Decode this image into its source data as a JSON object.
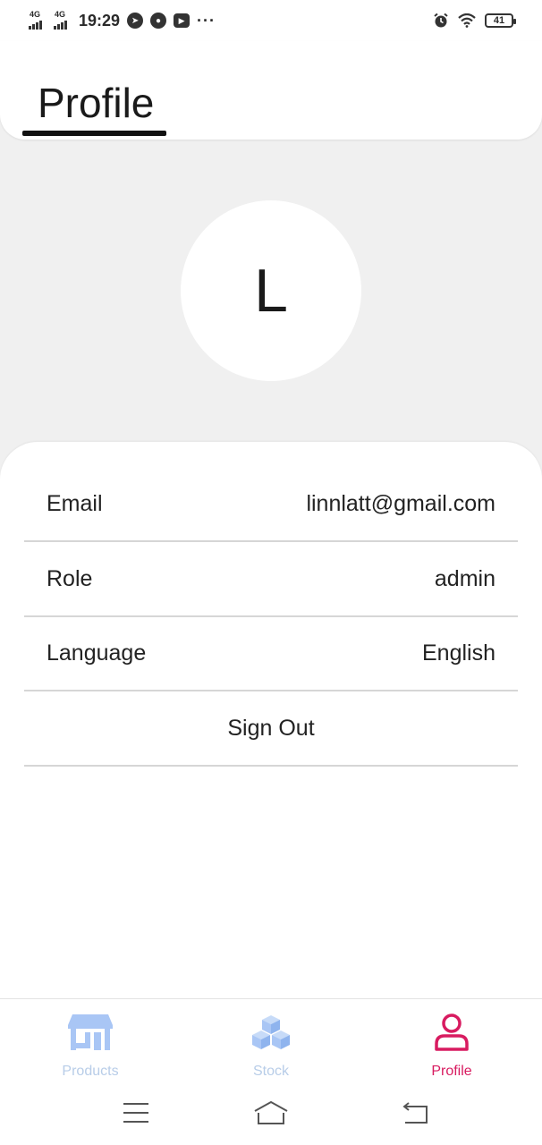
{
  "status_bar": {
    "time": "19:29",
    "network1": "4G",
    "network2": "4G",
    "battery": "41"
  },
  "header": {
    "title": "Profile"
  },
  "avatar": {
    "initial": "L"
  },
  "profile_rows": [
    {
      "label": "Email",
      "value": "linnlatt@gmail.com"
    },
    {
      "label": "Role",
      "value": "admin"
    },
    {
      "label": "Language",
      "value": "English"
    }
  ],
  "sign_out_label": "Sign Out",
  "bottom_nav": {
    "items": [
      {
        "label": "Products",
        "icon": "store-icon",
        "active": false
      },
      {
        "label": "Stock",
        "icon": "cubes-icon",
        "active": false
      },
      {
        "label": "Profile",
        "icon": "person-icon",
        "active": true
      }
    ],
    "active_color": "#d81b60",
    "inactive_icon_color": "#a9c6f5",
    "inactive_label_color": "#b8cde8"
  },
  "colors": {
    "background": "#f0f0f0",
    "surface": "#ffffff",
    "divider": "#d6d6d6"
  }
}
